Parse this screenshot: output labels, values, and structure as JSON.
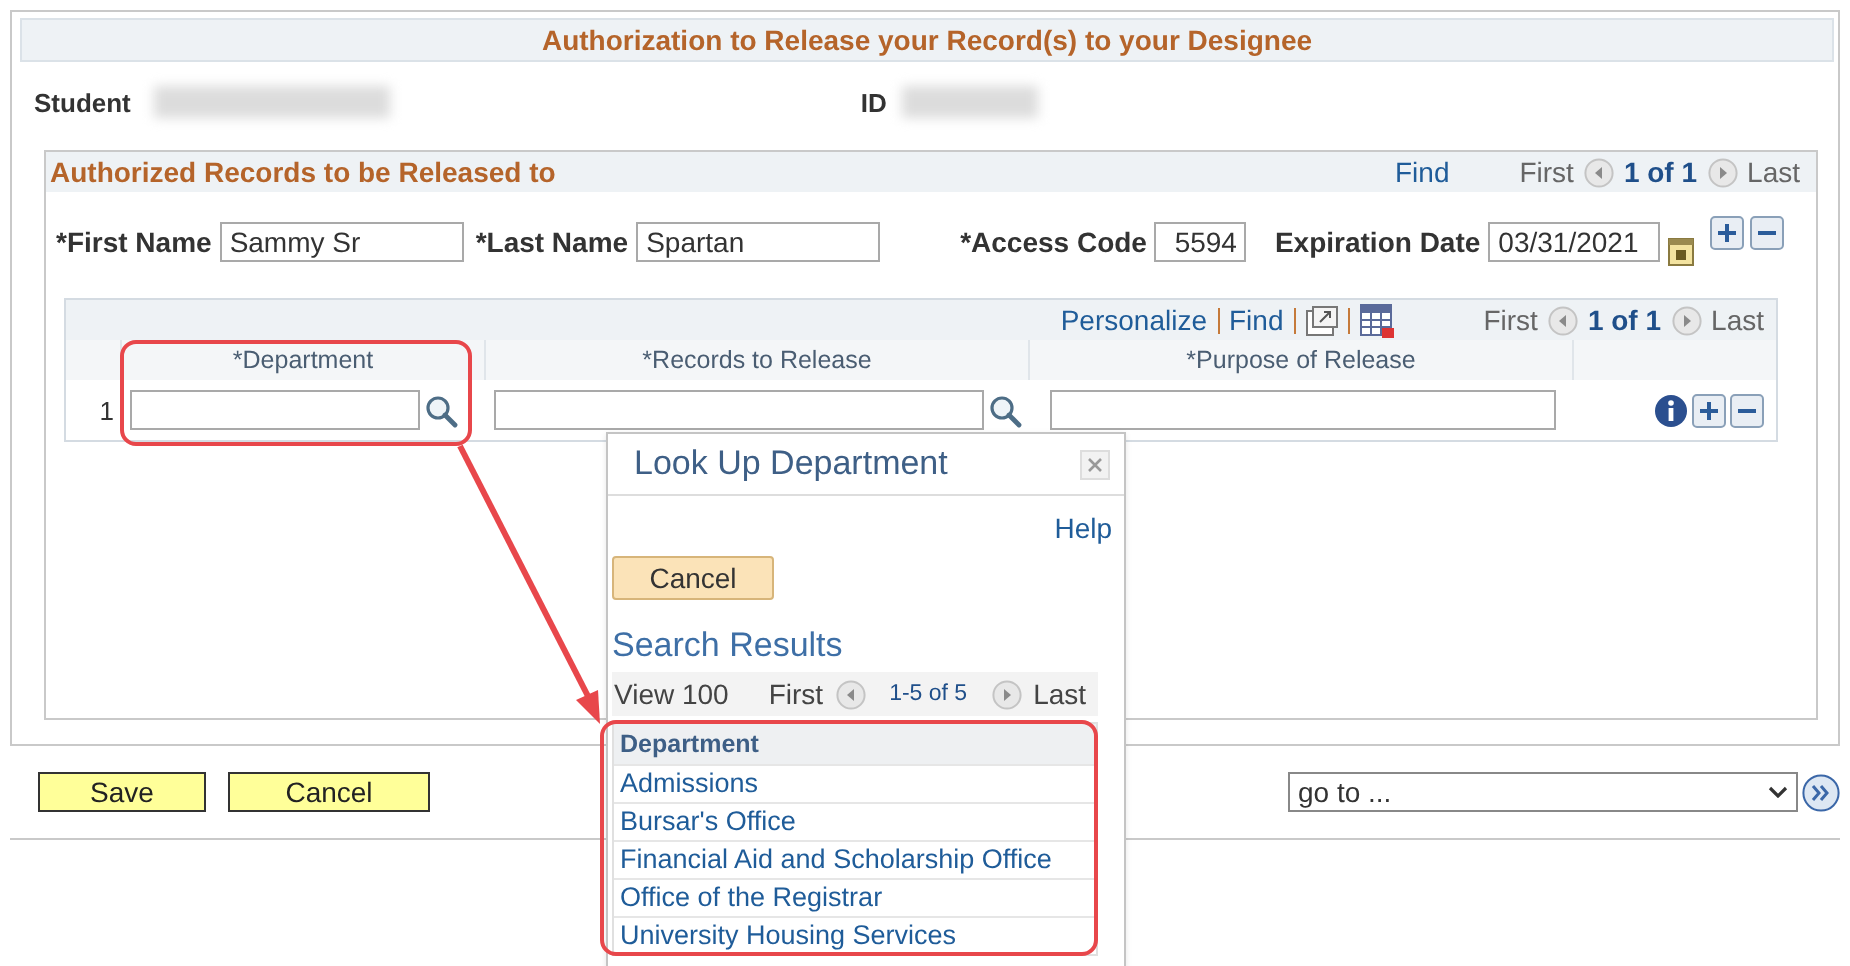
{
  "title": "Authorization to Release your Record(s) to your Designee",
  "student": {
    "label": "Student",
    "id_label": "ID"
  },
  "section": {
    "title": "Authorized Records to be Released to",
    "find": "Find",
    "nav": {
      "first": "First",
      "count": "1 of 1",
      "last": "Last"
    }
  },
  "fields": [
    {
      "label": "*First Name",
      "value": "Sammy Sr",
      "kind": "text"
    },
    {
      "label": "*Last Name",
      "value": "Spartan",
      "kind": "text"
    },
    {
      "label": "*Access Code",
      "value": "5594",
      "kind": "number"
    },
    {
      "label": "Expiration Date",
      "value": "03/31/2021",
      "kind": "date"
    }
  ],
  "grid": {
    "personalize": "Personalize",
    "find": "Find",
    "nav": {
      "first": "First",
      "count": "1 of 1",
      "last": "Last"
    },
    "columns": [
      "*Department",
      "*Records to Release",
      "*Purpose of Release"
    ],
    "rows": [
      {
        "number": "1"
      }
    ]
  },
  "lookup": {
    "title": "Look Up Department",
    "help": "Help",
    "cancel": "Cancel",
    "results_title": "Search Results",
    "view": "View 100",
    "nav": {
      "first": "First",
      "count": "1-5 of 5",
      "last": "Last"
    },
    "column": "Department",
    "rows": [
      "Admissions",
      "Bursar's Office",
      "Financial Aid and Scholarship Office",
      "Office of the Registrar",
      "University Housing Services"
    ]
  },
  "buttons": [
    "Save",
    "Cancel"
  ],
  "goto": {
    "value": "go to ..."
  }
}
